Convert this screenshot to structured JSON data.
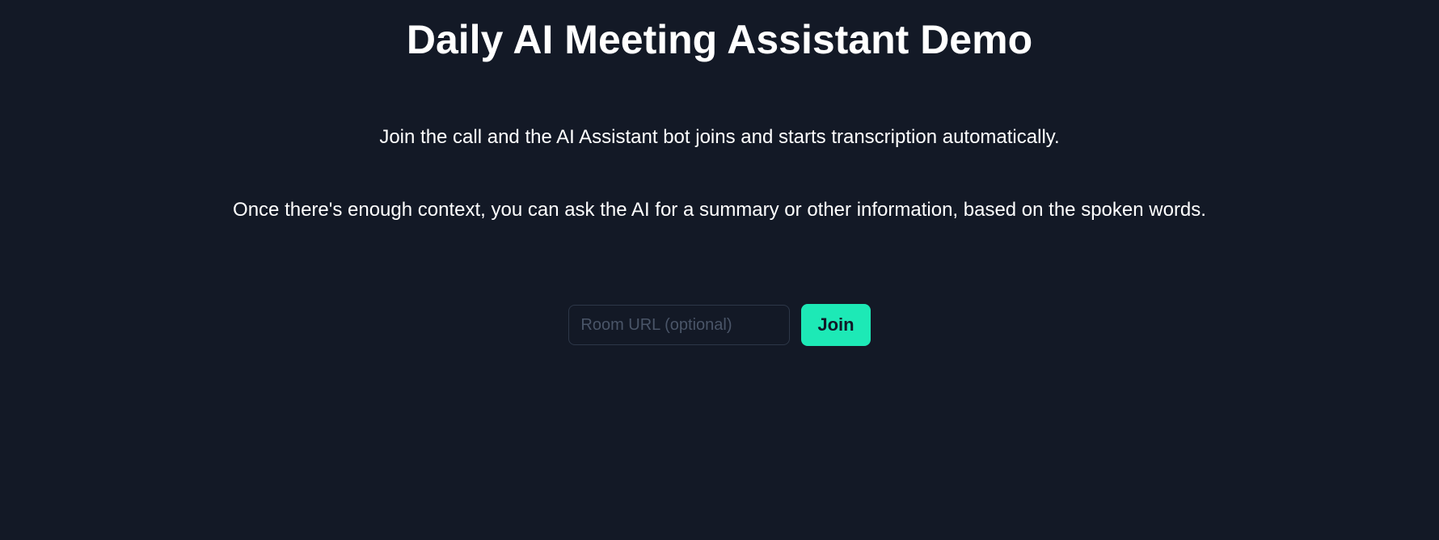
{
  "title": "Daily AI Meeting Assistant Demo",
  "description_1": "Join the call and the AI Assistant bot joins and starts transcription automatically.",
  "description_2": "Once there's enough context, you can ask the AI for a summary or other information, based on the spoken words.",
  "form": {
    "room_url_placeholder": "Room URL (optional)",
    "room_url_value": "",
    "join_button_label": "Join"
  }
}
